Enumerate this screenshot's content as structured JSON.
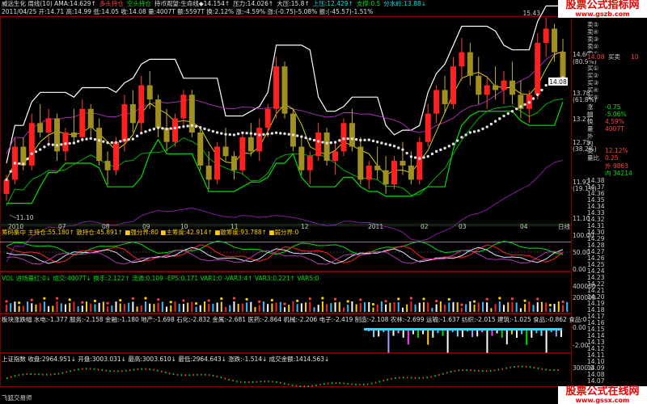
{
  "window": {
    "title_segments": [
      {
        "text": "威远生化 周线(10) AMA:14.629↑",
        "color": "#e0e0e0"
      },
      {
        "text": "多头持仓",
        "color": "#ff4040"
      },
      {
        "text": "空头持仓",
        "color": "#00e000"
      },
      {
        "text": "持币观望:生命线◆14.154↑",
        "color": "#e0e0e0"
      },
      {
        "text": "压力:14.026↑",
        "color": "#e0e0e0"
      },
      {
        "text": "大压:15.8↑",
        "color": "#e0e0e0"
      },
      {
        "text": "上压:12.429↑",
        "color": "#00e0e0"
      },
      {
        "text": "支撑:0.5",
        "color": "#00e000"
      },
      {
        "text": "分水岭:13.88↓",
        "color": "#00e0e0"
      }
    ],
    "row2": "2011/04/25 开:14.71 高:14.99 低:14.05 收:14.08 量:4007T 额:5597T 换:2.12% 涨:-4.59% 涨:(-0.75)-5.08% 振:(-45.57)-1.51%"
  },
  "watermark": {
    "line1": "股票公式指标网",
    "line2": "www.gszb.com",
    "bottom1": "股票公式在线网",
    "bottom2": "www.gssx.com"
  },
  "yaxis_main": [
    {
      "v": "15.43",
      "y": 17,
      "c": "#ccc"
    },
    {
      "v": "14.60",
      "y": 67,
      "c": "#ccc"
    },
    {
      "v": "(80.9%)",
      "y": 76,
      "c": "#ccc"
    },
    {
      "v": "13.78",
      "y": 115,
      "c": "#ccc"
    },
    {
      "v": "(61.8%)",
      "y": 123,
      "c": "#ccc"
    },
    {
      "v": "13.27",
      "y": 147,
      "c": "#ccc"
    },
    {
      "v": "12.75",
      "y": 176,
      "c": "#ccc"
    },
    {
      "v": "(38.2%)",
      "y": 184,
      "c": "#ccc"
    },
    {
      "v": "11.92",
      "y": 225,
      "c": "#ccc"
    },
    {
      "v": "(19.1%)",
      "y": 233,
      "c": "#ccc"
    },
    {
      "v": "11.10",
      "y": 270,
      "c": "#ccc"
    }
  ],
  "price_tag": "14.08",
  "low_label": "11.10",
  "high_label": "15.43",
  "x_axis": {
    "labels": [
      "2010",
      "07",
      "08",
      "09",
      "10",
      "11",
      "12",
      "2011",
      "02",
      "03",
      "04"
    ],
    "right": "日线"
  },
  "side_panel": {
    "header_label": "买卖",
    "header_val": "10",
    "current_price": "14.08",
    "rows": [
      {
        "l": "卖⑤",
        "p": "",
        "c": "#ff4040"
      },
      {
        "l": "卖④",
        "p": "",
        "c": "#ff4040"
      },
      {
        "l": "卖③",
        "p": "",
        "c": "#ff4040"
      },
      {
        "l": "卖②",
        "p": "",
        "c": "#ff4040"
      },
      {
        "l": "卖①",
        "p": "",
        "c": "#ff4040"
      },
      {
        "l": "",
        "p": "",
        "c": "#ff4040"
      },
      {
        "l": "买①",
        "p": "",
        "c": "#ff4040"
      },
      {
        "l": "买②",
        "p": "",
        "c": "#ff4040"
      },
      {
        "l": "买③",
        "p": "",
        "c": "#ff4040"
      },
      {
        "l": "买④",
        "p": "",
        "c": "#ff4040"
      },
      {
        "l": "买⑤",
        "p": "",
        "c": "#ff4040"
      }
    ],
    "stats": [
      {
        "l": "涨",
        "v": "-0.75",
        "v2": "14.75",
        "c": "#00e000"
      },
      {
        "l": "幅",
        "v": "-5.06%",
        "v2": "",
        "c": "#00e000"
      },
      {
        "l": "换",
        "v": "4.59%",
        "v2": "",
        "c": "#ff4040"
      },
      {
        "l": "量",
        "v": "4007T",
        "v2": "",
        "c": "#ff4040"
      },
      {
        "l": "外",
        "v": "",
        "v2": "",
        "c": "#ff4040"
      },
      {
        "l": "内",
        "v": "",
        "v2": "",
        "c": "#ff4040"
      },
      {
        "l": "委",
        "v": "12.12%",
        "v2": "",
        "c": "#ff4040"
      },
      {
        "l": "量比",
        "v": "0.25",
        "v2": "",
        "c": "#ff4040"
      }
    ],
    "outer": "外 9863",
    "inner": "内 34214",
    "ticks": [
      "14.38",
      "14.37",
      "14.36",
      "14.35",
      "14.34",
      "14.33",
      "14.32",
      "14.31",
      "14.30",
      "14.29",
      "14.28",
      "14.27",
      "14.26",
      "14.25",
      "14.24",
      "14.23",
      "14.22",
      "14.21",
      "14.20",
      "14.19",
      "14.18",
      "14.17",
      "14.16",
      "14.15",
      "14.14",
      "14.13",
      "14.12",
      "14.11",
      "14.10",
      "14.09",
      "14.08",
      "14.07",
      "14.06"
    ]
  },
  "indicator2": {
    "title": "筹码集中 主持仓:55.180↑ 散持仓:45.891↑ ■强分界:80 ■主筹度:42.914↑ ■散筹度:93.788↑ ■弱分界:0",
    "y_labels": [
      "100.00",
      "50.00",
      "0.00"
    ]
  },
  "indicator3": {
    "title": "VOL 进场量红:0↓ 成交:4007T↓ 换手:2.122↑ 流通:0.109 -EPS:0.171 VAR1:0 -VAR3:4↑ VAR3:0.221↑ VAR5:0",
    "y_labels": [
      "400000",
      "200000"
    ]
  },
  "indicator4": {
    "title": "板块涨跌幅 水电:-1.377 服务:-2.158 金融:-1.180 地产:-1.698 石化:-2.832 金属:-2.681 医药:-2.864 机械:-2.206 电子:-2.419 制造:-2.108 农林:-2.699 运输:-1.637 纺织:-2.015 建筑:-1.025 食品:-0.862 食品:0",
    "y_labels": [
      "0.00",
      "-2.00"
    ]
  },
  "indicator5": {
    "title": "上证指数 收盘:2964.951↓ 开盘:3003.031↓ 最高:3003.610↓ 最低:2964.643↓ 涨跌:-1.514↓ 成交金额:1414.563↓",
    "y_labels": [
      "3000.0"
    ],
    "bottom_left": "飞狐交易师"
  },
  "chart_data": {
    "type": "candlestick",
    "title": "威远生化 周线",
    "x_labels": [
      "2010",
      "07",
      "08",
      "09",
      "10",
      "11",
      "12",
      "2011",
      "02",
      "03",
      "04"
    ],
    "ylim": [
      11.1,
      15.43
    ],
    "last_close": 14.08,
    "candles": [
      [
        11.7,
        12.1,
        11.55,
        12.0
      ],
      [
        12.0,
        12.9,
        11.9,
        12.7
      ],
      [
        12.7,
        12.9,
        12.2,
        12.3
      ],
      [
        12.3,
        13.4,
        12.2,
        13.2
      ],
      [
        13.2,
        13.6,
        12.9,
        13.0
      ],
      [
        13.0,
        13.5,
        12.7,
        13.3
      ],
      [
        13.3,
        13.4,
        12.4,
        12.6
      ],
      [
        12.6,
        13.1,
        12.4,
        13.0
      ],
      [
        13.0,
        13.5,
        12.8,
        12.9
      ],
      [
        12.9,
        13.7,
        12.8,
        13.5
      ],
      [
        13.5,
        13.6,
        12.9,
        13.1
      ],
      [
        13.1,
        13.3,
        12.3,
        12.4
      ],
      [
        12.4,
        12.6,
        11.9,
        12.2
      ],
      [
        12.2,
        12.9,
        12.1,
        12.8
      ],
      [
        12.8,
        13.8,
        12.6,
        13.6
      ],
      [
        13.6,
        13.9,
        13.0,
        13.2
      ],
      [
        13.2,
        14.2,
        13.0,
        14.0
      ],
      [
        14.0,
        14.3,
        13.5,
        13.7
      ],
      [
        13.7,
        13.8,
        12.9,
        13.1
      ],
      [
        13.1,
        13.5,
        12.6,
        12.8
      ],
      [
        12.8,
        13.4,
        12.7,
        13.3
      ],
      [
        13.3,
        13.9,
        13.1,
        13.8
      ],
      [
        13.8,
        13.9,
        12.9,
        13.0
      ],
      [
        13.0,
        13.1,
        12.2,
        12.3
      ],
      [
        12.3,
        12.6,
        11.8,
        12.0
      ],
      [
        12.0,
        12.8,
        11.9,
        12.7
      ],
      [
        12.7,
        13.1,
        12.4,
        12.5
      ],
      [
        12.5,
        12.6,
        12.0,
        12.2
      ],
      [
        12.2,
        13.0,
        12.1,
        12.9
      ],
      [
        12.9,
        13.2,
        12.5,
        12.6
      ],
      [
        12.6,
        13.3,
        12.4,
        13.1
      ],
      [
        13.1,
        13.6,
        12.9,
        13.5
      ],
      [
        13.5,
        14.6,
        13.3,
        14.4
      ],
      [
        14.4,
        14.5,
        13.3,
        13.4
      ],
      [
        13.4,
        13.5,
        12.6,
        12.7
      ],
      [
        12.7,
        12.9,
        12.1,
        12.2
      ],
      [
        12.2,
        12.6,
        11.9,
        12.5
      ],
      [
        12.5,
        13.2,
        12.4,
        13.0
      ],
      [
        13.0,
        13.1,
        12.3,
        12.4
      ],
      [
        12.4,
        12.8,
        12.1,
        12.6
      ],
      [
        12.6,
        13.3,
        12.5,
        13.2
      ],
      [
        13.2,
        13.5,
        12.6,
        12.7
      ],
      [
        12.7,
        12.9,
        11.9,
        12.0
      ],
      [
        12.0,
        12.4,
        11.8,
        12.3
      ],
      [
        12.3,
        12.7,
        12.0,
        12.2
      ],
      [
        12.2,
        12.5,
        11.7,
        11.9
      ],
      [
        11.9,
        12.5,
        11.8,
        12.4
      ],
      [
        12.4,
        12.8,
        12.1,
        12.3
      ],
      [
        12.3,
        12.6,
        11.9,
        12.0
      ],
      [
        12.0,
        12.9,
        11.9,
        12.8
      ],
      [
        12.8,
        13.6,
        12.7,
        13.4
      ],
      [
        13.4,
        14.0,
        13.2,
        13.9
      ],
      [
        13.9,
        14.2,
        13.4,
        13.6
      ],
      [
        13.6,
        14.6,
        13.5,
        14.4
      ],
      [
        14.4,
        15.0,
        14.1,
        14.7
      ],
      [
        14.7,
        14.9,
        14.0,
        14.2
      ],
      [
        14.2,
        14.6,
        13.6,
        13.8
      ],
      [
        13.8,
        14.2,
        13.5,
        14.0
      ],
      [
        14.0,
        14.4,
        13.7,
        13.9
      ],
      [
        13.9,
        14.3,
        13.6,
        14.1
      ],
      [
        14.1,
        14.5,
        13.6,
        13.8
      ],
      [
        13.8,
        14.1,
        13.3,
        13.5
      ],
      [
        13.5,
        13.9,
        13.2,
        13.8
      ],
      [
        13.8,
        15.1,
        13.7,
        14.9
      ],
      [
        14.9,
        15.43,
        14.6,
        15.2
      ],
      [
        15.2,
        15.3,
        14.5,
        14.7
      ],
      [
        14.71,
        14.99,
        14.05,
        14.08
      ]
    ]
  }
}
